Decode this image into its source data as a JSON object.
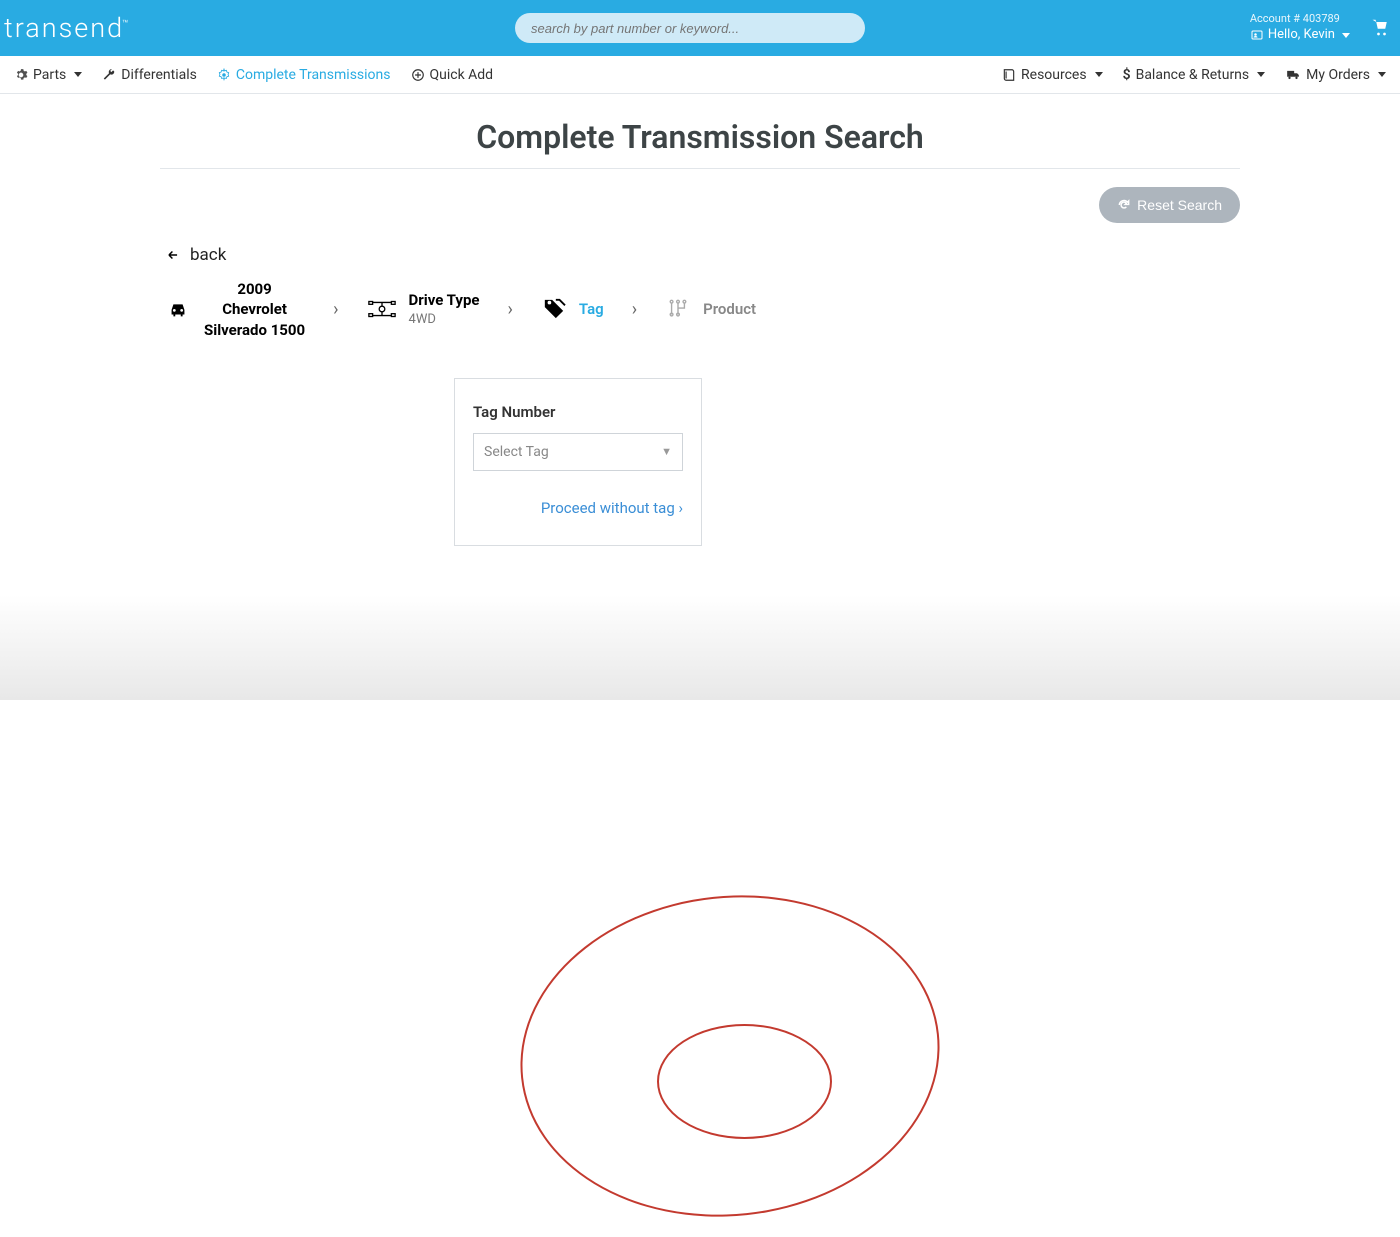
{
  "header": {
    "logo": "transend",
    "search_placeholder": "search by part number or keyword...",
    "account_label": "Account # 403789",
    "greeting": "Hello, Kevin"
  },
  "nav": {
    "parts": "Parts",
    "differentials": "Differentials",
    "complete_transmissions": "Complete Transmissions",
    "quick_add": "Quick Add",
    "resources": "Resources",
    "balance_returns": "Balance & Returns",
    "my_orders": "My Orders"
  },
  "page": {
    "title": "Complete Transmission Search",
    "reset_label": "Reset Search",
    "back_label": "back"
  },
  "breadcrumb": {
    "vehicle": {
      "year": "2009",
      "make": "Chevrolet",
      "model": "Silverado 1500"
    },
    "drive_type": {
      "title": "Drive Type",
      "value": "4WD"
    },
    "tag": {
      "title": "Tag"
    },
    "product": {
      "title": "Product"
    }
  },
  "tag_card": {
    "label": "Tag Number",
    "placeholder": "Select Tag",
    "proceed_label": "Proceed without tag ›"
  }
}
